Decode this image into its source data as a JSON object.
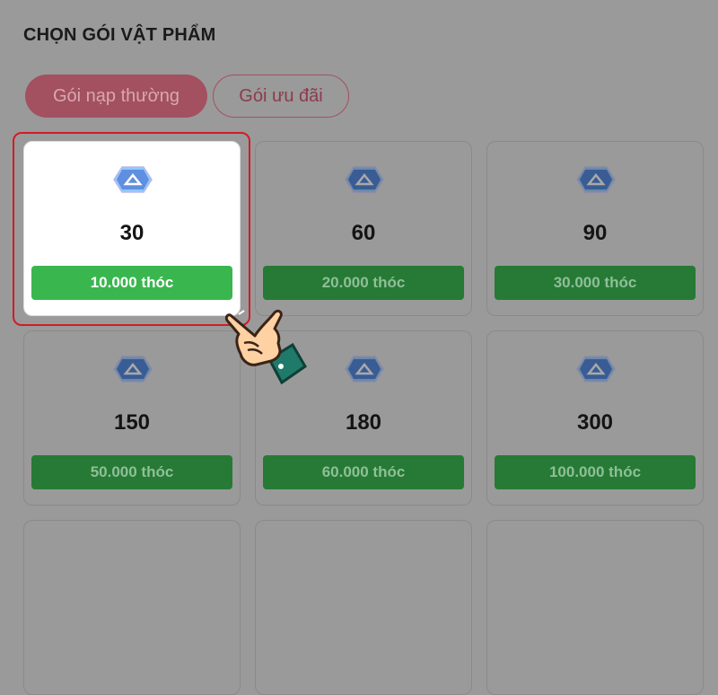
{
  "section": {
    "title": "CHỌN GÓI VẬT PHẨM"
  },
  "tabs": [
    {
      "label": "Gói nạp thường",
      "active": true
    },
    {
      "label": "Gói ưu đãi",
      "active": false
    }
  ],
  "packages": [
    {
      "amount": "30",
      "price": "10.000 thóc",
      "selected": true
    },
    {
      "amount": "60",
      "price": "20.000 thóc",
      "selected": false
    },
    {
      "amount": "90",
      "price": "30.000 thóc",
      "selected": false
    },
    {
      "amount": "150",
      "price": "50.000 thóc",
      "selected": false
    },
    {
      "amount": "180",
      "price": "60.000 thóc",
      "selected": false
    },
    {
      "amount": "300",
      "price": "100.000 thóc",
      "selected": false
    }
  ],
  "colors": {
    "accent": "#d21c24",
    "price_button_active": "#3ab64f",
    "price_button_dimmed": "#267a35",
    "tab_active": "#a35060"
  },
  "icons": {
    "gem": "gem-icon",
    "cursor": "pointing-hand-icon"
  }
}
